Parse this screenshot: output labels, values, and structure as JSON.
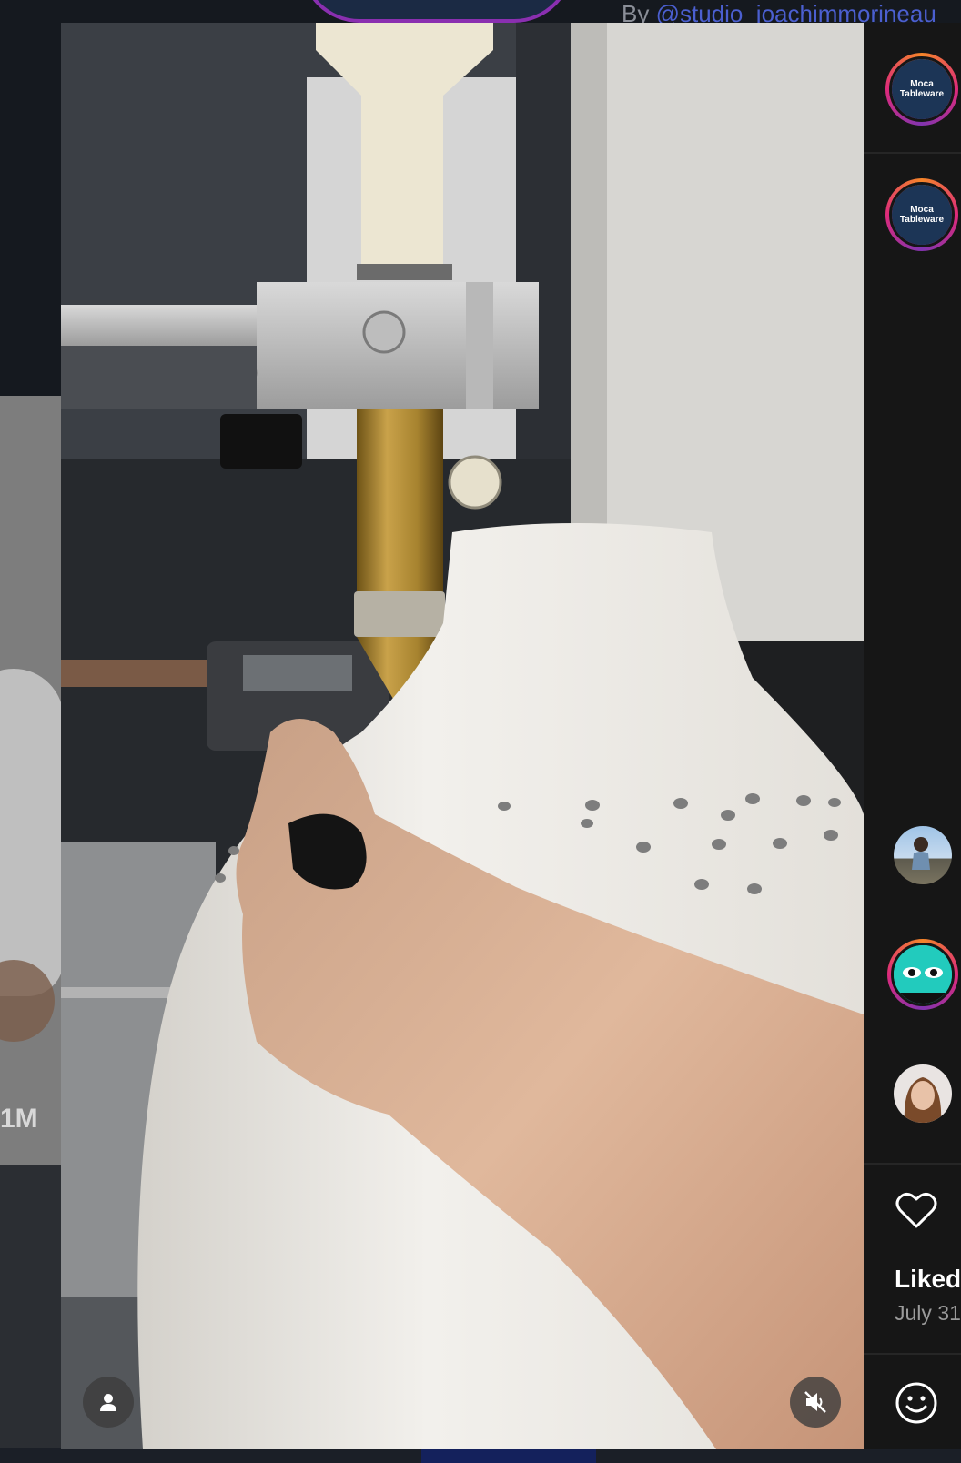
{
  "header": {
    "by_prefix": "By",
    "author_handle": "@studio_joachimmorineau"
  },
  "left_card": {
    "count": "1M"
  },
  "stories": [
    {
      "name": "moca-tableware-1",
      "line1": "Moca",
      "line2": "Tableware",
      "ring": true
    },
    {
      "name": "moca-tableware-2",
      "line1": "Moca",
      "line2": "Tableware",
      "ring": true
    },
    {
      "name": "user-avatar-outdoor",
      "ring": false
    },
    {
      "name": "user-avatar-green-face",
      "ring": true
    },
    {
      "name": "user-avatar-portrait",
      "ring": false
    }
  ],
  "activity": {
    "liked_label": "Liked",
    "date": "July 31"
  },
  "icons": {
    "user": "user-icon",
    "mute": "mute-icon",
    "heart": "heart-icon",
    "emoji": "emoji-icon"
  },
  "colors": {
    "rail_bg": "#161616",
    "story_ring": "#dd2a7b",
    "handle_link": "#4b5fd0"
  }
}
